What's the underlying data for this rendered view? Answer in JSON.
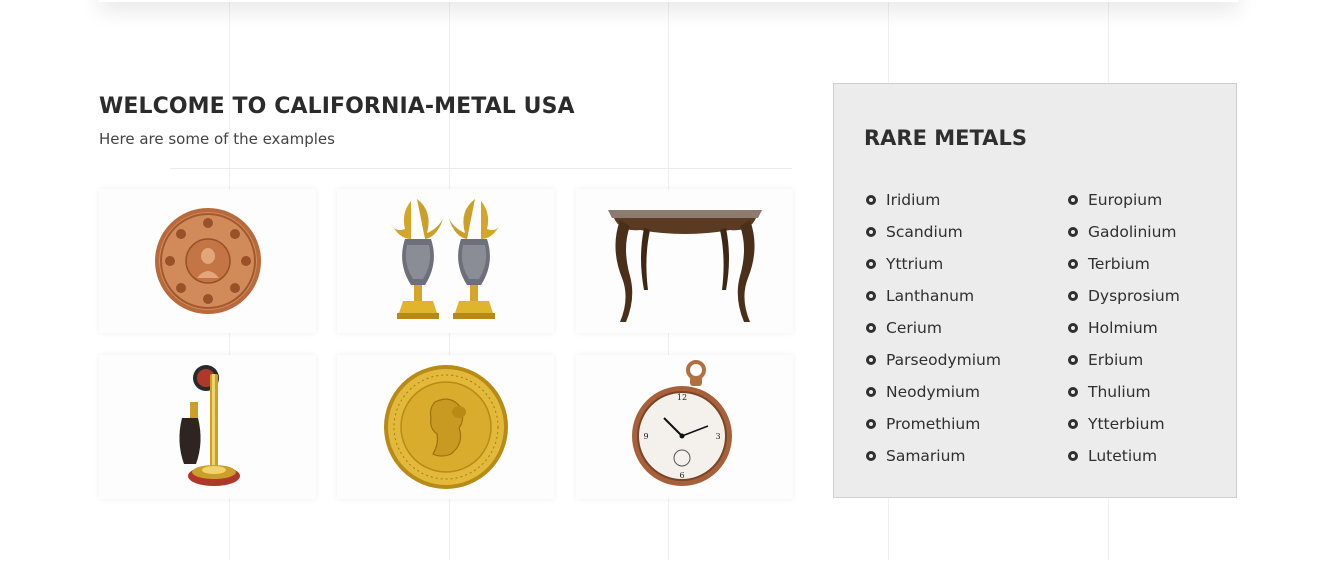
{
  "intro": {
    "heading": "WELCOME TO CALIFORNIA-METAL USA",
    "subheading": "Here are some of the examples"
  },
  "gallery": {
    "items": [
      {
        "icon": "copper-coin-icon"
      },
      {
        "icon": "golden-ewers-icon"
      },
      {
        "icon": "antique-table-icon"
      },
      {
        "icon": "candlestick-telephone-icon"
      },
      {
        "icon": "gold-sovereign-coin-icon"
      },
      {
        "icon": "pocket-watch-icon"
      }
    ]
  },
  "rare_metals": {
    "title": "RARE METALS",
    "column1": [
      "Iridium",
      "Scandium",
      "Yttrium",
      "Lanthanum",
      "Cerium",
      "Parseodymium",
      "Neodymium",
      "Promethium",
      "Samarium"
    ],
    "column2": [
      "Europium",
      "Gadolinium",
      "Terbium",
      "Dysprosium",
      "Holmium",
      "Erbium",
      "Thulium",
      "Ytterbium",
      "Lutetium"
    ]
  },
  "colors": {
    "panel_background": "#ececec",
    "heading_text": "#2b2b2b",
    "gold": "#d4a526",
    "copper": "#c8784a"
  }
}
